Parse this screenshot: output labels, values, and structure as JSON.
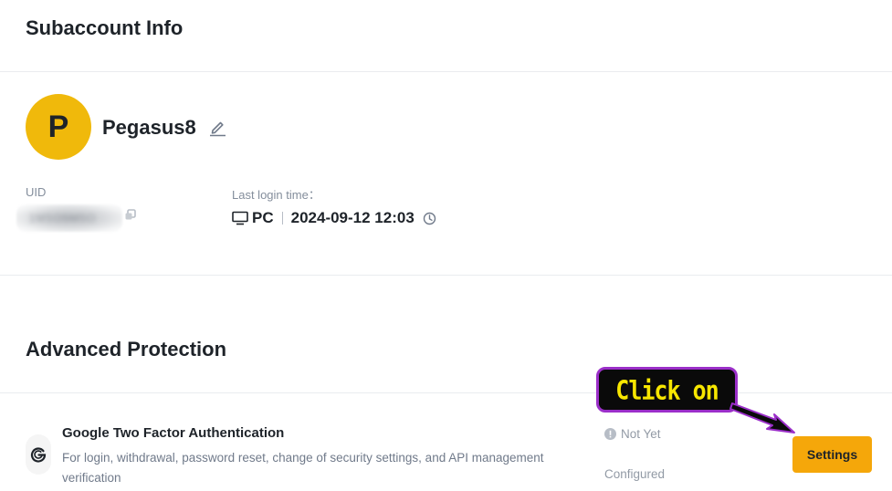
{
  "subaccount_info": {
    "title": "Subaccount Info",
    "avatar_letter": "P",
    "username": "Pegasus8",
    "uid_label": "UID",
    "uid_value": "1M5O5M5O",
    "last_login_label": "Last login time：",
    "last_login_device": "PC",
    "last_login_time": "2024-09-12 12:03"
  },
  "advanced_protection": {
    "title": "Advanced Protection",
    "items": [
      {
        "title": "Google Two Factor Authentication",
        "description": "For login, withdrawal, password reset, change of security settings, and API management verification",
        "status": "Not Yet",
        "status_sub": "Configured",
        "action_label": "Settings"
      }
    ]
  },
  "annotation": {
    "callout_text": "Click on"
  },
  "colors": {
    "accent": "#f5a70a",
    "avatar": "#f0b90b",
    "callout_border": "#9b2fc9",
    "callout_text": "#f7e600"
  },
  "icons": {
    "edit": "pencil-icon",
    "copy": "copy-icon",
    "device": "monitor-icon",
    "clock": "clock-icon",
    "google": "google-icon",
    "status": "exclamation-icon"
  }
}
